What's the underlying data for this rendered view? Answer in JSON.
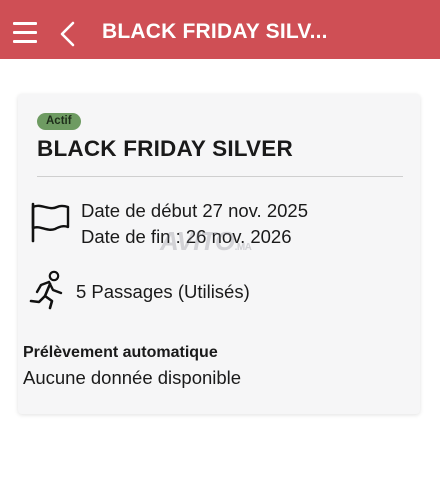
{
  "app_bar": {
    "title": "BLACK FRIDAY SILV...",
    "background": "#cf4f55",
    "menu_icon": "hamburger-menu-icon",
    "back_icon": "chevron-left-icon"
  },
  "subscription": {
    "status_badge": "Actif",
    "badge_color": "#6e9b62",
    "name": "BLACK FRIDAY SILVER",
    "date_icon": "flag-icon",
    "start_date": "Date de début 27 nov. 2025",
    "end_date": "Date de fin : 26 nov. 2026",
    "passages_icon": "running-person-icon",
    "passages": "5 Passages (Utilisés)",
    "auto_debit_label": "Prélèvement automatique",
    "auto_debit_value": "Aucune donnée disponible"
  },
  "watermark": {
    "brand": "AVITO",
    "suffix": ".MA"
  }
}
